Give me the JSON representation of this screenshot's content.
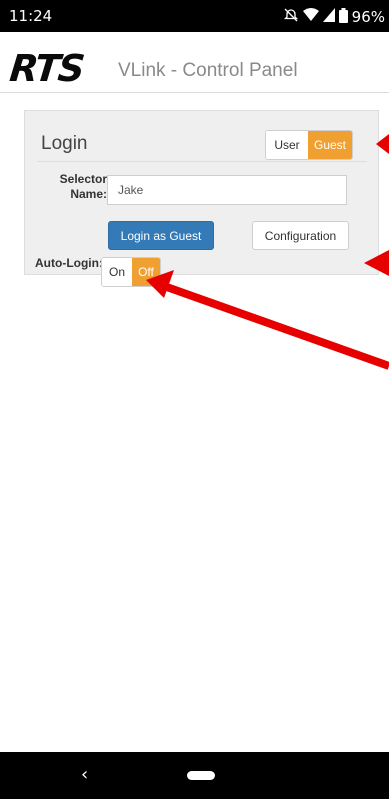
{
  "status_bar": {
    "time": "11:24",
    "battery": "96%",
    "icons": [
      "alarm-off-icon",
      "wifi-icon",
      "signal-icon",
      "battery-icon"
    ]
  },
  "header": {
    "logo_text": "RTS",
    "title": "VLink - Control Panel"
  },
  "login_panel": {
    "title": "Login",
    "mode_toggle": {
      "options": [
        "User",
        "Guest"
      ],
      "selected": "Guest"
    },
    "selector_name_label": "Selector Name:",
    "selector_name_value": "Jake",
    "login_button": "Login as Guest",
    "configuration_button": "Configuration",
    "auto_login_label": "Auto-Login:",
    "auto_login_toggle": {
      "options": [
        "On",
        "Off"
      ],
      "selected": "Off"
    }
  },
  "nav_bar": {
    "back_glyph": "‹"
  },
  "colors": {
    "accent_orange": "#f0a030",
    "primary_blue": "#337ab7",
    "annotation_red": "#e60000",
    "panel_bg": "#efefef"
  }
}
